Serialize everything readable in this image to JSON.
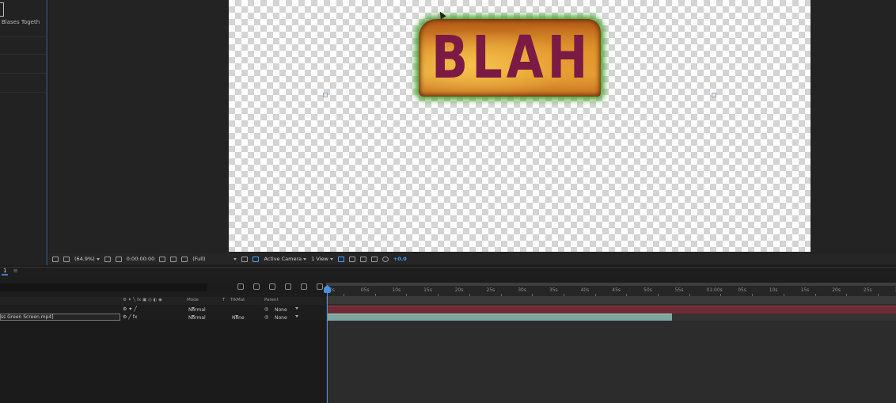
{
  "project": {
    "item_label": "Blases Togeth"
  },
  "composition": {
    "text": "BLAH"
  },
  "viewer_toolbar": {
    "zoom": "(64.9%)",
    "timecode": "0:00:00:00",
    "resolution": "(Full)",
    "camera": "Active Camera",
    "views": "1 View",
    "exposure": "+0.0"
  },
  "timeline": {
    "tab_label": "1",
    "columns": {
      "mode": "Mode",
      "t": "T",
      "trkmat": "TrkMat",
      "parent": "Parent"
    },
    "layers": [
      {
        "name": "",
        "mode": "Normal",
        "trkmat": "",
        "parent": "None"
      },
      {
        "name": "ss Green Screen.mp4]",
        "mode": "Normal",
        "trkmat": "None",
        "parent": "None"
      }
    ],
    "ruler_ticks": [
      "0s",
      "05s",
      "10s",
      "15s",
      "20s",
      "25s",
      "30s",
      "35s",
      "40s",
      "45s",
      "50s",
      "55s",
      "01:00s",
      "05s",
      "10s",
      "15s",
      "20s",
      "25s",
      "30"
    ]
  },
  "colors": {
    "accent": "#4a90e2",
    "layer_red": "#6e2b35",
    "layer_teal": "#7ea6a1",
    "text_fill": "#7b1a45"
  }
}
